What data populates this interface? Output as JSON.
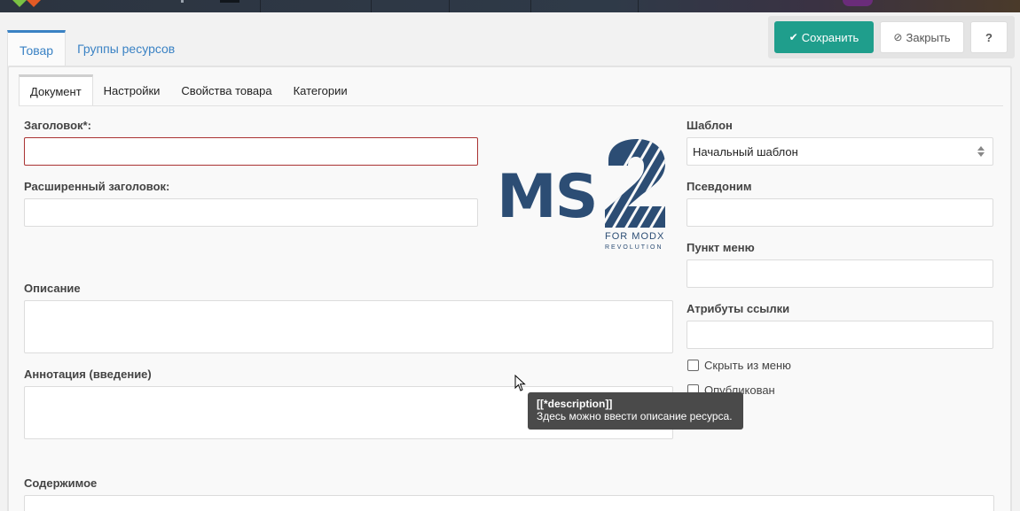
{
  "toolbar": {
    "save_label": "Сохранить",
    "close_label": "Закрыть",
    "help_label": "?",
    "save_icon": "check-icon",
    "close_icon": "ban-icon",
    "accent_color": "#1f9e8c"
  },
  "outer_tabs": [
    {
      "label": "Товар",
      "active": true
    },
    {
      "label": "Группы ресурсов",
      "active": false
    }
  ],
  "inner_tabs": [
    {
      "label": "Документ",
      "active": true
    },
    {
      "label": "Настройки",
      "active": false
    },
    {
      "label": "Свойства товара",
      "active": false
    },
    {
      "label": "Категории",
      "active": false
    }
  ],
  "left_fields": {
    "title_label": "Заголовок*:",
    "title_value": "",
    "longtitle_label": "Расширенный заголовок:",
    "longtitle_value": "",
    "description_label": "Описание",
    "description_value": "",
    "introtext_label": "Аннотация (введение)",
    "introtext_value": "",
    "content_label": "Содержимое"
  },
  "logo": {
    "main": "MS",
    "line1": "FOR MODX",
    "line2": "REVOLUTION"
  },
  "right_fields": {
    "template_label": "Шаблон",
    "template_value": "Начальный шаблон",
    "alias_label": "Псевдоним",
    "alias_value": "",
    "menutitle_label": "Пункт меню",
    "menutitle_value": "",
    "linkattr_label": "Атрибуты ссылки",
    "linkattr_value": "",
    "hidemenu_label": "Скрыть из меню",
    "hidemenu_checked": false,
    "published_label": "Опубликован",
    "published_checked": false
  },
  "tooltip": {
    "title": "[[*description]]",
    "text": "Здесь можно ввести описание ресурса."
  }
}
